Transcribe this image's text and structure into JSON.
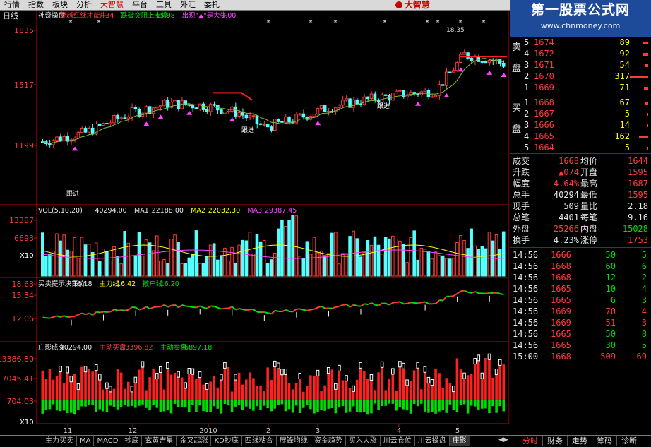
{
  "menu": {
    "items": [
      "行情",
      "指数",
      "板块",
      "分析",
      "大智慧",
      "平台",
      "工具",
      "外汇",
      "委托"
    ],
    "active": "大智慧"
  },
  "logo": {
    "text": "大智慧"
  },
  "watermark": {
    "line1": "第一股票公式网",
    "line2": "www.chnmoney.com"
  },
  "main_panel": {
    "period": "日线",
    "legend": [
      {
        "text": "神奇操盘",
        "color": "#e8e8e8"
      },
      {
        "text": "穿越红线才能牛",
        "color": "#ff3b3b"
      },
      {
        "text": "17.34",
        "color": "#ff3b3b"
      },
      {
        "text": "跌破突阻上支撑",
        "color": "#00e000"
      },
      {
        "text": "15.98",
        "color": "#00e000"
      },
      {
        "text": "出现\"▲\"是大牛",
        "color": "#ff44ff"
      },
      {
        "text": "0.00",
        "color": "#ff44ff"
      }
    ],
    "y_labels": [
      "1835",
      "1517",
      "1199"
    ],
    "peak_label": "18.35",
    "annotation": "跟进"
  },
  "vol_panel": {
    "legend": [
      {
        "text": "VOL(5,10,20)",
        "color": "#e8e8e8"
      },
      {
        "text": "40294.00",
        "color": "#e8e8e8"
      },
      {
        "text": "MA1",
        "color": "#e8e8e8"
      },
      {
        "text": "22188.00",
        "color": "#e8e8e8"
      },
      {
        "text": "MA2",
        "color": "#ffff00"
      },
      {
        "text": "22032.30",
        "color": "#ffff00"
      },
      {
        "text": "MA3",
        "color": "#ff44ff"
      },
      {
        "text": "29387.45",
        "color": "#ff44ff"
      }
    ],
    "y_labels": [
      "13387",
      "6693"
    ],
    "unit": "X10"
  },
  "decision_panel": {
    "legend": [
      {
        "text": "买卖提示决策价",
        "color": "#e8e8e8"
      },
      {
        "text": "16.18",
        "color": "#e8e8e8"
      },
      {
        "text": "主力线",
        "color": "#ffff00"
      },
      {
        "text": "16.42",
        "color": "#ffff00"
      },
      {
        "text": "散户线",
        "color": "#00e000"
      },
      {
        "text": "16.20",
        "color": "#00e000"
      }
    ],
    "y_labels": [
      "18.63",
      "15.34",
      "12.06"
    ]
  },
  "zhuang_panel": {
    "legend": [
      {
        "text": "庄影成交",
        "color": "#e8e8e8"
      },
      {
        "text": "40294.00",
        "color": "#e8e8e8"
      },
      {
        "text": "主动买盘",
        "color": "#ff3b3b"
      },
      {
        "text": "33396.82",
        "color": "#ff3b3b"
      },
      {
        "text": "主动卖盘",
        "color": "#00e000"
      },
      {
        "text": "-6897.18",
        "color": "#00e000"
      }
    ],
    "y_labels": [
      "13386.80",
      "7045.41",
      "704.03"
    ],
    "unit": "X10"
  },
  "x_axis": {
    "labels": [
      "11",
      "12",
      "2010",
      "2",
      "3",
      "4",
      "5"
    ]
  },
  "order_book": {
    "sell_label": [
      "卖",
      "盘"
    ],
    "buy_label": [
      "买",
      "盘"
    ],
    "sell": [
      {
        "n": "5",
        "price": "1674",
        "vol": "89"
      },
      {
        "n": "4",
        "price": "1672",
        "vol": "92"
      },
      {
        "n": "3",
        "price": "1671",
        "vol": "54"
      },
      {
        "n": "2",
        "price": "1670",
        "vol": "317"
      },
      {
        "n": "1",
        "price": "1669",
        "vol": "71"
      }
    ],
    "buy": [
      {
        "n": "1",
        "price": "1668",
        "vol": "67"
      },
      {
        "n": "2",
        "price": "1667",
        "vol": "5"
      },
      {
        "n": "3",
        "price": "1666",
        "vol": "14"
      },
      {
        "n": "4",
        "price": "1665",
        "vol": "162"
      },
      {
        "n": "5",
        "price": "1664",
        "vol": "5"
      }
    ]
  },
  "stats": [
    {
      "l1": "成交",
      "v1": "1668",
      "c1": "red",
      "l2": "均价",
      "v2": "1644",
      "c2": "red"
    },
    {
      "l1": "升跌",
      "v1": "▲074",
      "c1": "red",
      "l2": "开盘",
      "v2": "1595",
      "c2": "red"
    },
    {
      "l1": "幅度",
      "v1": "4.64%",
      "c1": "red",
      "l2": "最高",
      "v2": "1687",
      "c2": "red"
    },
    {
      "l1": "总手",
      "v1": "40294",
      "c1": "white",
      "l2": "最低",
      "v2": "1595",
      "c2": "red"
    },
    {
      "l1": "现手",
      "v1": "509",
      "c1": "white",
      "l2": "量比",
      "v2": "2.18",
      "c2": "white"
    },
    {
      "l1": "总笔",
      "v1": "4401",
      "c1": "white",
      "l2": "每笔",
      "v2": "9.16",
      "c2": "white"
    },
    {
      "l1": "外盘",
      "v1": "25266",
      "c1": "red",
      "l2": "内盘",
      "v2": "15028",
      "c2": "green"
    },
    {
      "l1": "换手",
      "v1": "4.23%",
      "c1": "white",
      "l2": "涨停",
      "v2": "1753",
      "c2": "red"
    }
  ],
  "ticks": [
    {
      "t": "14:56",
      "p": "1666",
      "v": "50",
      "n": "5",
      "vc": "green"
    },
    {
      "t": "14:56",
      "p": "1668",
      "v": "60",
      "n": "6",
      "vc": "green"
    },
    {
      "t": "14:56",
      "p": "1668",
      "v": "12",
      "n": "2",
      "vc": "green"
    },
    {
      "t": "14:56",
      "p": "1665",
      "v": "10",
      "n": "4",
      "vc": "green"
    },
    {
      "t": "14:56",
      "p": "1665",
      "v": "6",
      "n": "3",
      "vc": "green"
    },
    {
      "t": "14:56",
      "p": "1669",
      "v": "70",
      "n": "4",
      "vc": "red"
    },
    {
      "t": "14:56",
      "p": "1669",
      "v": "51",
      "n": "3",
      "vc": "red"
    },
    {
      "t": "14:56",
      "p": "1665",
      "v": "50",
      "n": "8",
      "vc": "green"
    },
    {
      "t": "14:56",
      "p": "1665",
      "v": "30",
      "n": "5",
      "vc": "green"
    },
    {
      "t": "15:00",
      "p": "1668",
      "v": "509",
      "n": "69",
      "vc": "red"
    }
  ],
  "bottom_tabs": [
    "主力买卖",
    "MA",
    "MACD",
    "抄底",
    "玄黄吉星",
    "金叉起涨",
    "KD抄底",
    "四线粘合",
    "展锋均线",
    "资金趋势",
    "买入大涨",
    "川云仓位",
    "川云操盘",
    "庄影"
  ],
  "bottom_active": "庄影",
  "right_tabs": [
    "分时",
    "财务",
    "走势",
    "筹码",
    "诊断"
  ],
  "right_active": "分时"
}
